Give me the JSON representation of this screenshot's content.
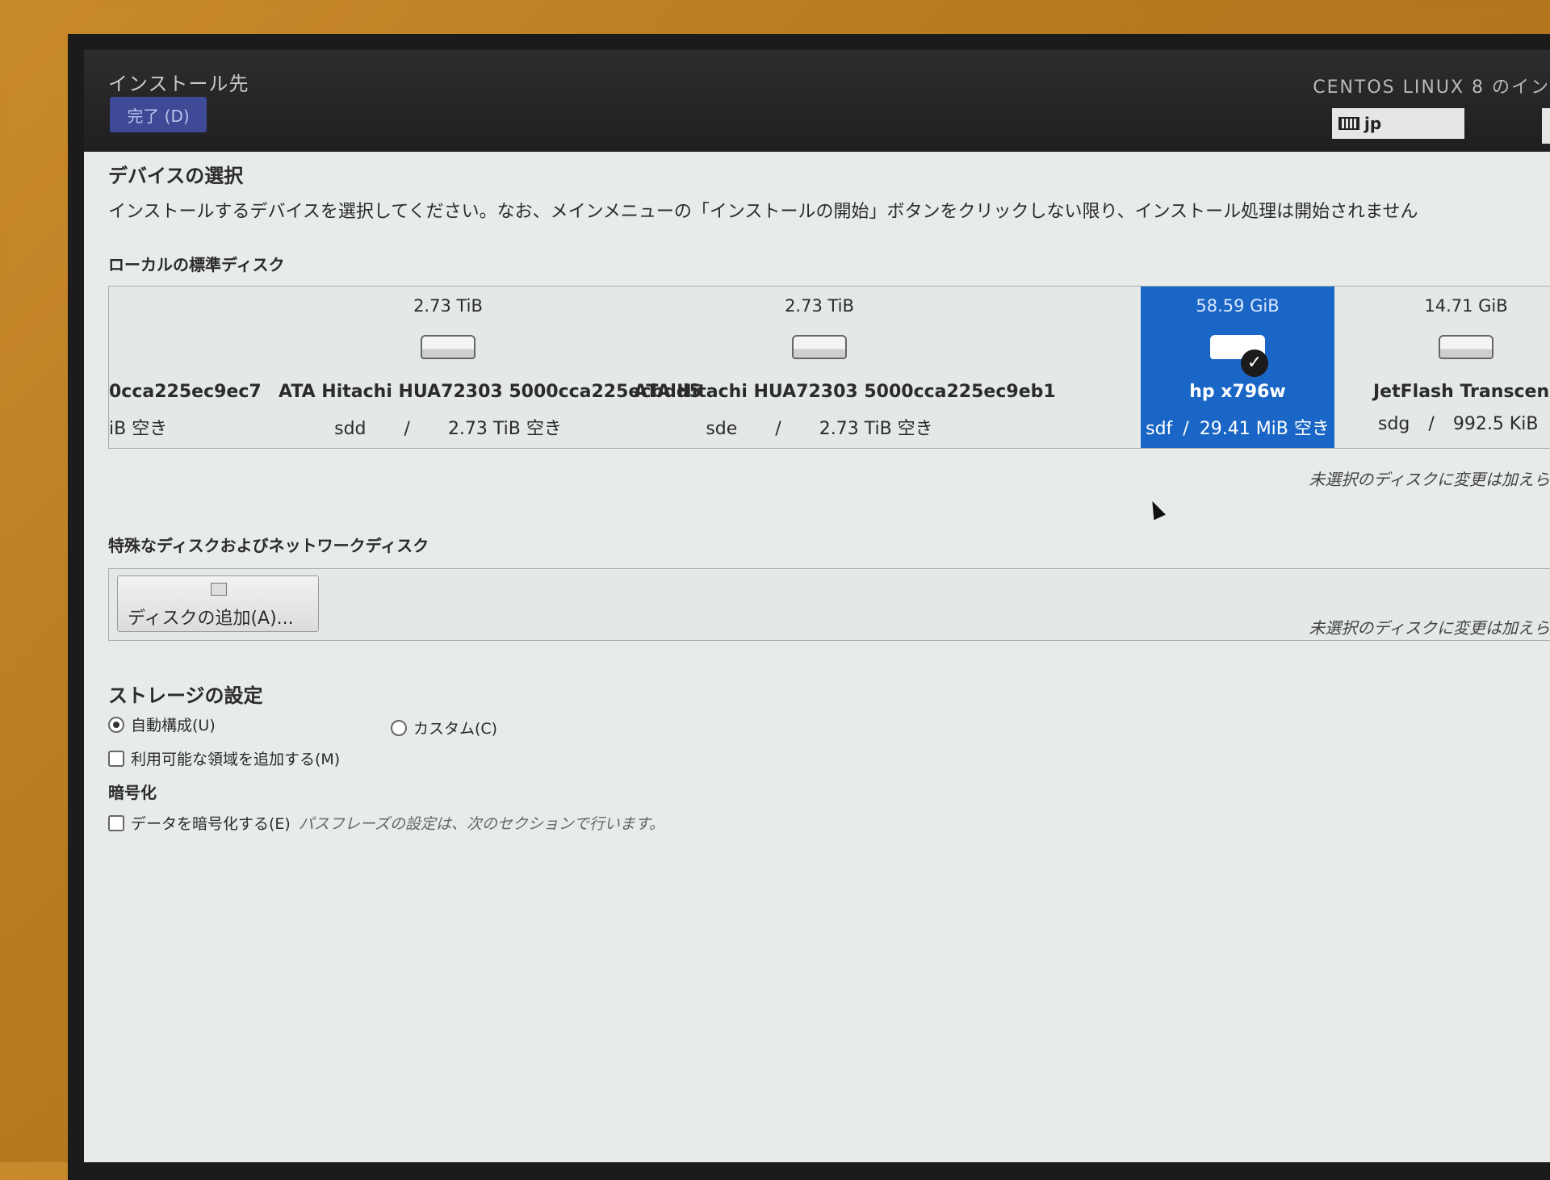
{
  "header": {
    "title": "インストール先",
    "done_label": "完了 (D)",
    "brand": "CENTOS LINUX 8 のイン",
    "keyboard_layout": "jp"
  },
  "device_selection": {
    "title": "デバイスの選択",
    "description": "インストールするデバイスを選択してください。なお、メインメニューの「インストールの開始」ボタンをクリックしない限り、インストール処理は開始されません"
  },
  "local_disks": {
    "title": "ローカルの標準ディスク",
    "disks": [
      {
        "size": "",
        "name": "0cca225ec9ec7",
        "dev": "",
        "free": "iB 空き",
        "selected": false
      },
      {
        "size": "2.73 TiB",
        "name": "ATA Hitachi HUA72303 5000cca225ecbdd5",
        "dev": "sdd",
        "free": "2.73 TiB 空き",
        "selected": false
      },
      {
        "size": "2.73 TiB",
        "name": "ATA Hitachi HUA72303 5000cca225ec9eb1",
        "dev": "sde",
        "free": "2.73 TiB 空き",
        "selected": false
      },
      {
        "size": "58.59 GiB",
        "name": "hp x796w",
        "dev": "sdf",
        "free": "29.41 MiB 空き",
        "selected": true
      },
      {
        "size": "14.71 GiB",
        "name": "JetFlash Transcend",
        "dev": "sdg",
        "free": "992.5 KiB",
        "selected": false
      }
    ],
    "note": "未選択のディスクに変更は加えら",
    "separator": "/"
  },
  "special_disks": {
    "title": "特殊なディスクおよびネットワークディスク",
    "add_button": "ディスクの追加(A)...",
    "note": "未選択のディスクに変更は加えら"
  },
  "storage": {
    "title": "ストレージの設定",
    "auto_label": "自動構成(U)",
    "custom_label": "カスタム(C)",
    "selected": "auto",
    "reclaim_label": "利用可能な領域を追加する(M)"
  },
  "encryption": {
    "title": "暗号化",
    "encrypt_label": "データを暗号化する(E)",
    "hint": "パスフレーズの設定は、次のセクションで行います。"
  }
}
